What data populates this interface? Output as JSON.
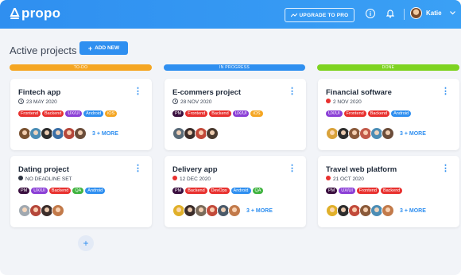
{
  "brand": {
    "name": "propo"
  },
  "header": {
    "upgrade_label": "UPGRADE TO PRO",
    "user_name": "Katie"
  },
  "page": {
    "title": "Active projects",
    "add_new_label": "ADD NEW"
  },
  "columns": [
    {
      "label": "TO-DO",
      "color": "#f5a623"
    },
    {
      "label": "IN PROGRESS",
      "color": "#2f8ff0"
    },
    {
      "label": "DONE",
      "color": "#7ed321"
    }
  ],
  "tag_colors": {
    "PM": "#3a0f3f",
    "Frontend": "#e8312f",
    "Backend": "#e8312f",
    "UX/UI": "#8b3fd6",
    "Android": "#2f8ff0",
    "iOS": "#f5a623",
    "QA": "#3fb33f",
    "DevOps": "#e8312f"
  },
  "cards": [
    {
      "title": "Fintech app",
      "date": "23 MAY 2020",
      "status": "clock",
      "tags": [
        "Frontend",
        "Backend",
        "UX/UI",
        "Android",
        "iOS"
      ],
      "avatar_colors": [
        "#7a5230",
        "#4b8db5",
        "#2d2d2d",
        "#3a6ea5",
        "#b5473a",
        "#6b4d3a"
      ],
      "more": "3 + MORE"
    },
    {
      "title": "E-commers project",
      "date": "28 NOV 2020",
      "status": "clock",
      "tags": [
        "PM",
        "Frontend",
        "Backend",
        "UX/UI",
        "iOS"
      ],
      "avatar_colors": [
        "#5a6b78",
        "#3b2d2a",
        "#c24a3a",
        "#4a3a2f"
      ],
      "more": ""
    },
    {
      "title": "Financial software",
      "date": "2 NOV 2020",
      "status": "overdue",
      "tags": [
        "UX/UI",
        "Frontend",
        "Backend",
        "Android"
      ],
      "avatar_colors": [
        "#d9a23a",
        "#2d2d2d",
        "#8a5a3a",
        "#c25a4a",
        "#4b8db5",
        "#6b4d3a"
      ],
      "more": "3 + MORE"
    },
    {
      "title": "Dating project",
      "date": "NO DEADLINE SET",
      "status": "none",
      "tags": [
        "PM",
        "UX/UI",
        "Backend",
        "QA",
        "Android"
      ],
      "avatar_colors": [
        "#a0a8b0",
        "#b5473a",
        "#3b2d2a",
        "#c27a4a"
      ],
      "more": ""
    },
    {
      "title": "Delivery app",
      "date": "12 DEC 2020",
      "status": "overdue",
      "tags": [
        "PM",
        "Backend",
        "DevOps",
        "Android",
        "QA"
      ],
      "avatar_colors": [
        "#e0b02a",
        "#3b2d2a",
        "#7a6b5a",
        "#c24a3a",
        "#4a5a6a",
        "#c27a4a"
      ],
      "more": "3 + MORE"
    },
    {
      "title": "Travel web platform",
      "date": "21 OCT 2020",
      "status": "overdue",
      "tags": [
        "PM",
        "UX/UI",
        "Frontend",
        "Backend"
      ],
      "avatar_colors": [
        "#e0b02a",
        "#2d2d2d",
        "#c24a3a",
        "#8a5a3a",
        "#4b8db5",
        "#c27a4a"
      ],
      "more": "3 + MORE"
    }
  ]
}
